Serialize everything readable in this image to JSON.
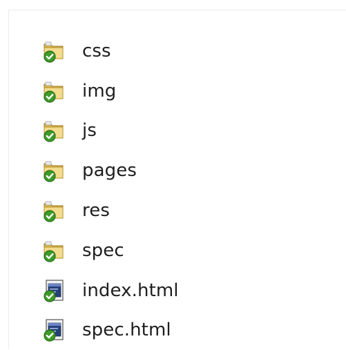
{
  "explorer": {
    "items": [
      {
        "name": "css",
        "type": "folder",
        "icon": "folder-synced-icon",
        "status": "synced"
      },
      {
        "name": "img",
        "type": "folder",
        "icon": "folder-synced-icon",
        "status": "synced"
      },
      {
        "name": "js",
        "type": "folder",
        "icon": "folder-synced-icon",
        "status": "synced"
      },
      {
        "name": "pages",
        "type": "folder",
        "icon": "folder-synced-icon",
        "status": "synced"
      },
      {
        "name": "res",
        "type": "folder",
        "icon": "folder-synced-icon",
        "status": "synced"
      },
      {
        "name": "spec",
        "type": "folder",
        "icon": "folder-synced-icon",
        "status": "synced"
      },
      {
        "name": "index.html",
        "type": "file",
        "icon": "html-file-synced-icon",
        "status": "synced"
      },
      {
        "name": "spec.html",
        "type": "file",
        "icon": "html-file-synced-icon",
        "status": "synced"
      }
    ]
  },
  "colors": {
    "folder_light": "#f3dc8c",
    "folder_dark": "#c9a23c",
    "check_green": "#3f9b2a",
    "check_dark": "#236b14",
    "file_blue": "#27407a",
    "text": "#1e1e1e"
  }
}
